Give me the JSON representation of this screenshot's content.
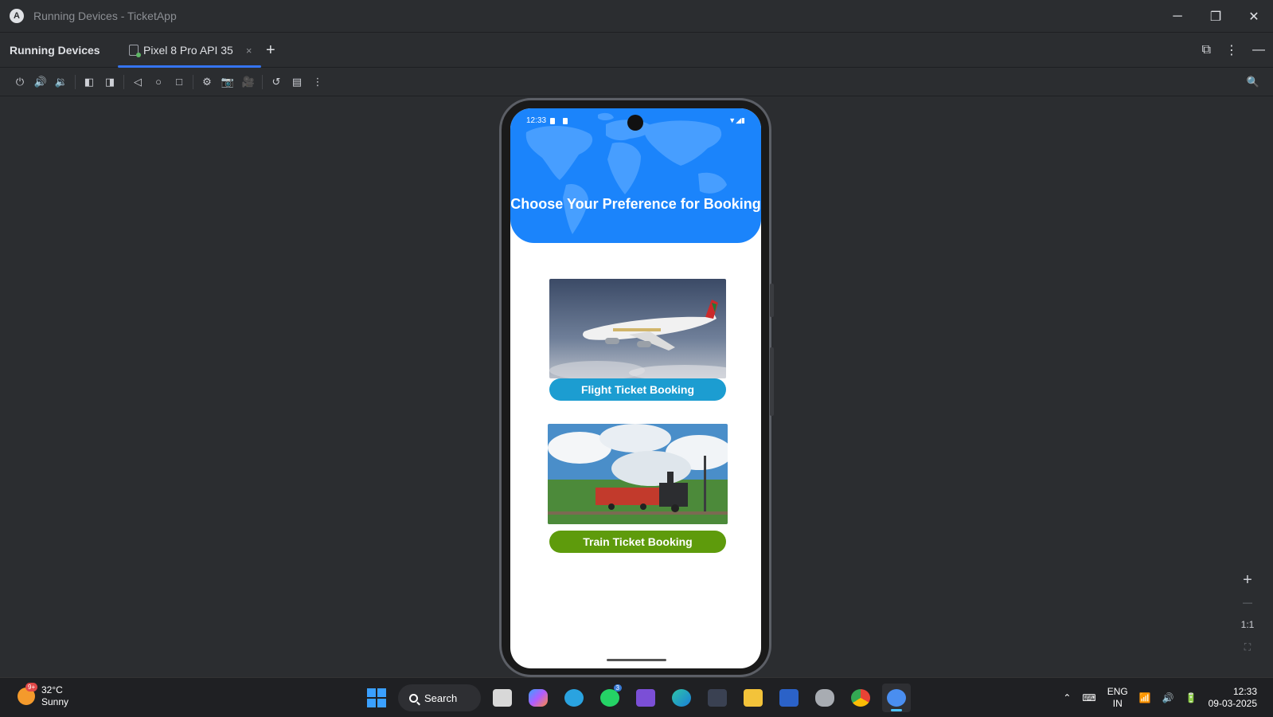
{
  "window": {
    "title": "Running Devices - TicketApp"
  },
  "panel": {
    "title": "Running Devices",
    "tab_label": "Pixel 8 Pro API 35",
    "tab_close": "×",
    "tab_add": "+"
  },
  "zoom": {
    "ratio_label": "1:1"
  },
  "phone": {
    "status_time": "12:33",
    "header_title": "Choose Your Preference for Booking",
    "flight_button": "Flight Ticket Booking",
    "train_button": "Train Ticket Booking",
    "colors": {
      "header": "#1b84fb",
      "flight_button": "#1c9dd1",
      "train_button": "#5e9b0c"
    }
  },
  "taskbar": {
    "weather_temp": "32°C",
    "weather_desc": "Sunny",
    "weather_badge": "9+",
    "search_label": "Search",
    "whatsapp_badge": "3",
    "lang_top": "ENG",
    "lang_bottom": "IN",
    "time": "12:33",
    "date": "09-03-2025"
  }
}
